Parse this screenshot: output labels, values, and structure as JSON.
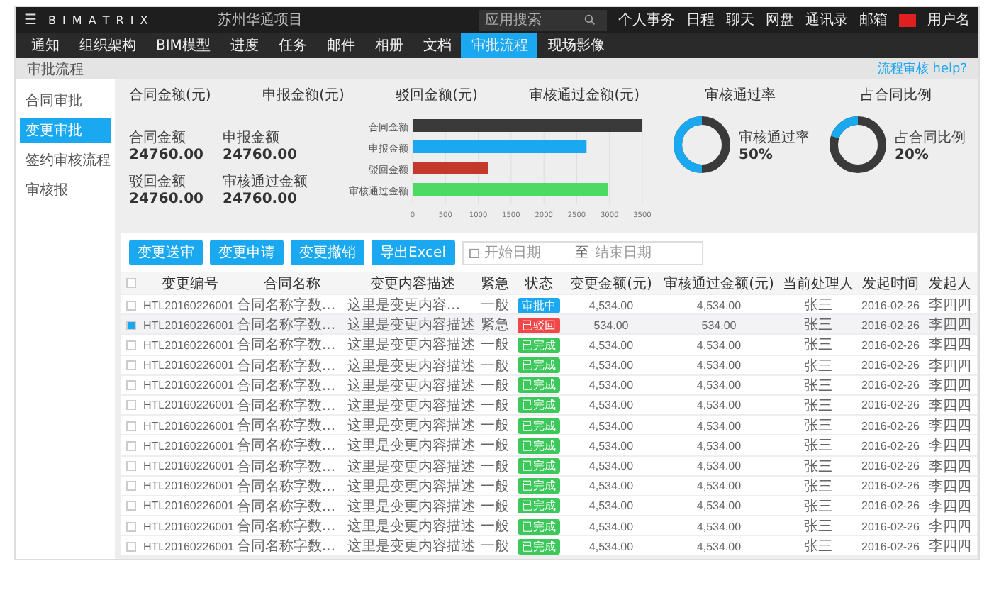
{
  "topbar": {
    "menu_icon": "☰",
    "logo": "B I M A T R I X",
    "project": "苏州华通项目",
    "search": {
      "placeholder": "应用搜索"
    },
    "links": [
      "个人事务",
      "日程",
      "聊天",
      "网盘",
      "通讯录",
      "邮箱"
    ],
    "user": "用户名"
  },
  "tabs": [
    {
      "label": "通知",
      "selected": false
    },
    {
      "label": "组织架构",
      "selected": false
    },
    {
      "label": "BIM模型",
      "selected": false
    },
    {
      "label": "进度",
      "selected": false
    },
    {
      "label": "任务",
      "selected": false
    },
    {
      "label": "邮件",
      "selected": false
    },
    {
      "label": "相册",
      "selected": false
    },
    {
      "label": "文档",
      "selected": false
    },
    {
      "label": "审批流程",
      "selected": true
    },
    {
      "label": "现场影像",
      "selected": false
    }
  ],
  "breadcrumb": "审批流程",
  "help_link": "流程审核 help?",
  "sidebar": {
    "items": [
      {
        "label": "合同审批",
        "selected": false
      },
      {
        "label": "变更审批",
        "selected": true
      },
      {
        "label": "签约审核流程",
        "selected": false
      },
      {
        "label": "审核报",
        "selected": false
      }
    ]
  },
  "summary": {
    "headings": [
      "合同金额(元)",
      "申报金额(元)",
      "驳回金额(元)",
      "审核通过金额(元)"
    ],
    "stats": [
      {
        "label": "合同金额",
        "value": "24760.00"
      },
      {
        "label": "申报金额",
        "value": "24760.00"
      },
      {
        "label": "驳回金额",
        "value": "24760.00"
      },
      {
        "label": "审核通过金额",
        "value": "24760.00"
      }
    ],
    "chart_data": {
      "type": "bar",
      "orientation": "horizontal",
      "grid": true,
      "series": [
        {
          "name": "合同金额",
          "color": "#3a3a3a",
          "values": [
            3500,
            null,
            null,
            null
          ]
        },
        {
          "name": "申报金额",
          "color": "#1aa8f0",
          "values": [
            null,
            2650,
            null,
            null
          ]
        },
        {
          "name": "驳回金额",
          "color": "#c0392b",
          "values": [
            null,
            null,
            1150,
            null
          ]
        },
        {
          "name": "审核通过金额",
          "color": "#4cd964",
          "values": [
            null,
            null,
            null,
            2980
          ]
        }
      ],
      "xlim": [
        0,
        3500
      ],
      "xticks": [
        0,
        500,
        1000,
        1500,
        2000,
        2500,
        3000,
        3500
      ]
    },
    "rates": [
      {
        "title": "审核通过率",
        "label": "审核通过率",
        "value": "50%",
        "level": 0.5
      },
      {
        "title": "占合同比例",
        "label": "占合同比例",
        "value": "20%",
        "level": 0.2
      }
    ]
  },
  "toolbar": {
    "buttons": [
      "变更送审",
      "变更申请",
      "变更撤销",
      "导出Excel"
    ],
    "date_range": {
      "start_placeholder": "开始日期",
      "separator": "至",
      "end_placeholder": "结束日期"
    }
  },
  "table": {
    "select_all": {
      "checked": false
    },
    "columns": [
      "变更编号",
      "合同名称",
      "变更内容描述",
      "紧急",
      "状态",
      "变更金额(元)",
      "审核通过金额(元)",
      "当前处理人",
      "发起时间",
      "发起人"
    ],
    "rows": [
      {
        "checked": false,
        "cells": [
          "HTL20160226001",
          "合同名称字数...",
          "这里是变更内容...",
          "一般",
          {
            "label": "审批中",
            "color": "#1aa8f0"
          },
          "4,534.00",
          "4,534.00",
          "张三",
          "2016-02-26",
          "李四四"
        ]
      },
      {
        "checked": true,
        "cells": [
          "HTL20160226001",
          "合同名称字数...",
          "这里是变更内容描述",
          "紧急",
          {
            "label": "已驳回",
            "color": "#f04848"
          },
          "534.00",
          "534.00",
          "张三",
          "2016-02-26",
          "李四四"
        ]
      },
      {
        "checked": false,
        "cells": [
          "HTL20160226001",
          "合同名称字数...",
          "这里是变更内容描述",
          "一般",
          {
            "label": "已完成",
            "color": "#3cc85a"
          },
          "4,534.00",
          "4,534.00",
          "张三",
          "2016-02-26",
          "李四四"
        ]
      },
      {
        "checked": false,
        "cells": [
          "HTL20160226001",
          "合同名称字数...",
          "这里是变更内容描述",
          "一般",
          {
            "label": "已完成",
            "color": "#3cc85a"
          },
          "4,534.00",
          "4,534.00",
          "张三",
          "2016-02-26",
          "李四四"
        ]
      },
      {
        "checked": false,
        "cells": [
          "HTL20160226001",
          "合同名称字数...",
          "这里是变更内容描述",
          "一般",
          {
            "label": "已完成",
            "color": "#3cc85a"
          },
          "4,534.00",
          "4,534.00",
          "张三",
          "2016-02-26",
          "李四四"
        ]
      },
      {
        "checked": false,
        "cells": [
          "HTL20160226001",
          "合同名称字数...",
          "这里是变更内容描述",
          "一般",
          {
            "label": "已完成",
            "color": "#3cc85a"
          },
          "4,534.00",
          "4,534.00",
          "张三",
          "2016-02-26",
          "李四四"
        ]
      },
      {
        "checked": false,
        "cells": [
          "HTL20160226001",
          "合同名称字数...",
          "这里是变更内容描述",
          "一般",
          {
            "label": "已完成",
            "color": "#3cc85a"
          },
          "4,534.00",
          "4,534.00",
          "张三",
          "2016-02-26",
          "李四四"
        ]
      },
      {
        "checked": false,
        "cells": [
          "HTL20160226001",
          "合同名称字数...",
          "这里是变更内容描述",
          "一般",
          {
            "label": "已完成",
            "color": "#3cc85a"
          },
          "4,534.00",
          "4,534.00",
          "张三",
          "2016-02-26",
          "李四四"
        ]
      },
      {
        "checked": false,
        "cells": [
          "HTL20160226001",
          "合同名称字数...",
          "这里是变更内容描述",
          "一般",
          {
            "label": "已完成",
            "color": "#3cc85a"
          },
          "4,534.00",
          "4,534.00",
          "张三",
          "2016-02-26",
          "李四四"
        ]
      },
      {
        "checked": false,
        "cells": [
          "HTL20160226001",
          "合同名称字数...",
          "这里是变更内容描述",
          "一般",
          {
            "label": "已完成",
            "color": "#3cc85a"
          },
          "4,534.00",
          "4,534.00",
          "张三",
          "2016-02-26",
          "李四四"
        ]
      },
      {
        "checked": false,
        "cells": [
          "HTL20160226001",
          "合同名称字数...",
          "这里是变更内容描述",
          "一般",
          {
            "label": "已完成",
            "color": "#3cc85a"
          },
          "4,534.00",
          "4,534.00",
          "张三",
          "2016-02-26",
          "李四四"
        ]
      },
      {
        "checked": false,
        "cells": [
          "HTL20160226001",
          "合同名称字数...",
          "这里是变更内容描述",
          "一般",
          {
            "label": "已完成",
            "color": "#3cc85a"
          },
          "4,534.00",
          "4,534.00",
          "张三",
          "2016-02-26",
          "李四四"
        ]
      },
      {
        "checked": false,
        "cells": [
          "HTL20160226001",
          "合同名称字数...",
          "这里是变更内容描述",
          "一般",
          {
            "label": "已完成",
            "color": "#3cc85a"
          },
          "4,534.00",
          "4,534.00",
          "张三",
          "2016-02-26",
          "李四四"
        ]
      }
    ]
  }
}
